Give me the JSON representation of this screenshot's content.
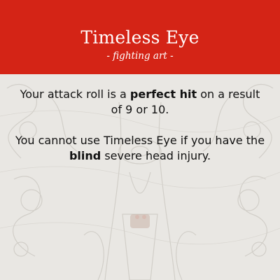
{
  "card": {
    "title": "Timeless Eye",
    "subtitle": "- fighting art -",
    "paragraph1": {
      "pre": "Your attack roll is a ",
      "bold": "perfect hit",
      "post": " on a result of 9 or 10."
    },
    "paragraph2": {
      "pre": "You cannot use Timeless Eye if you have the ",
      "bold": "blind",
      "post": " severe head injury."
    }
  },
  "colors": {
    "header_red": "#d42416",
    "background": "#e9e7e3",
    "text": "#111111",
    "title_text": "#ffffff"
  },
  "icons": {
    "background_art": "ornate-engraved-illustration"
  }
}
